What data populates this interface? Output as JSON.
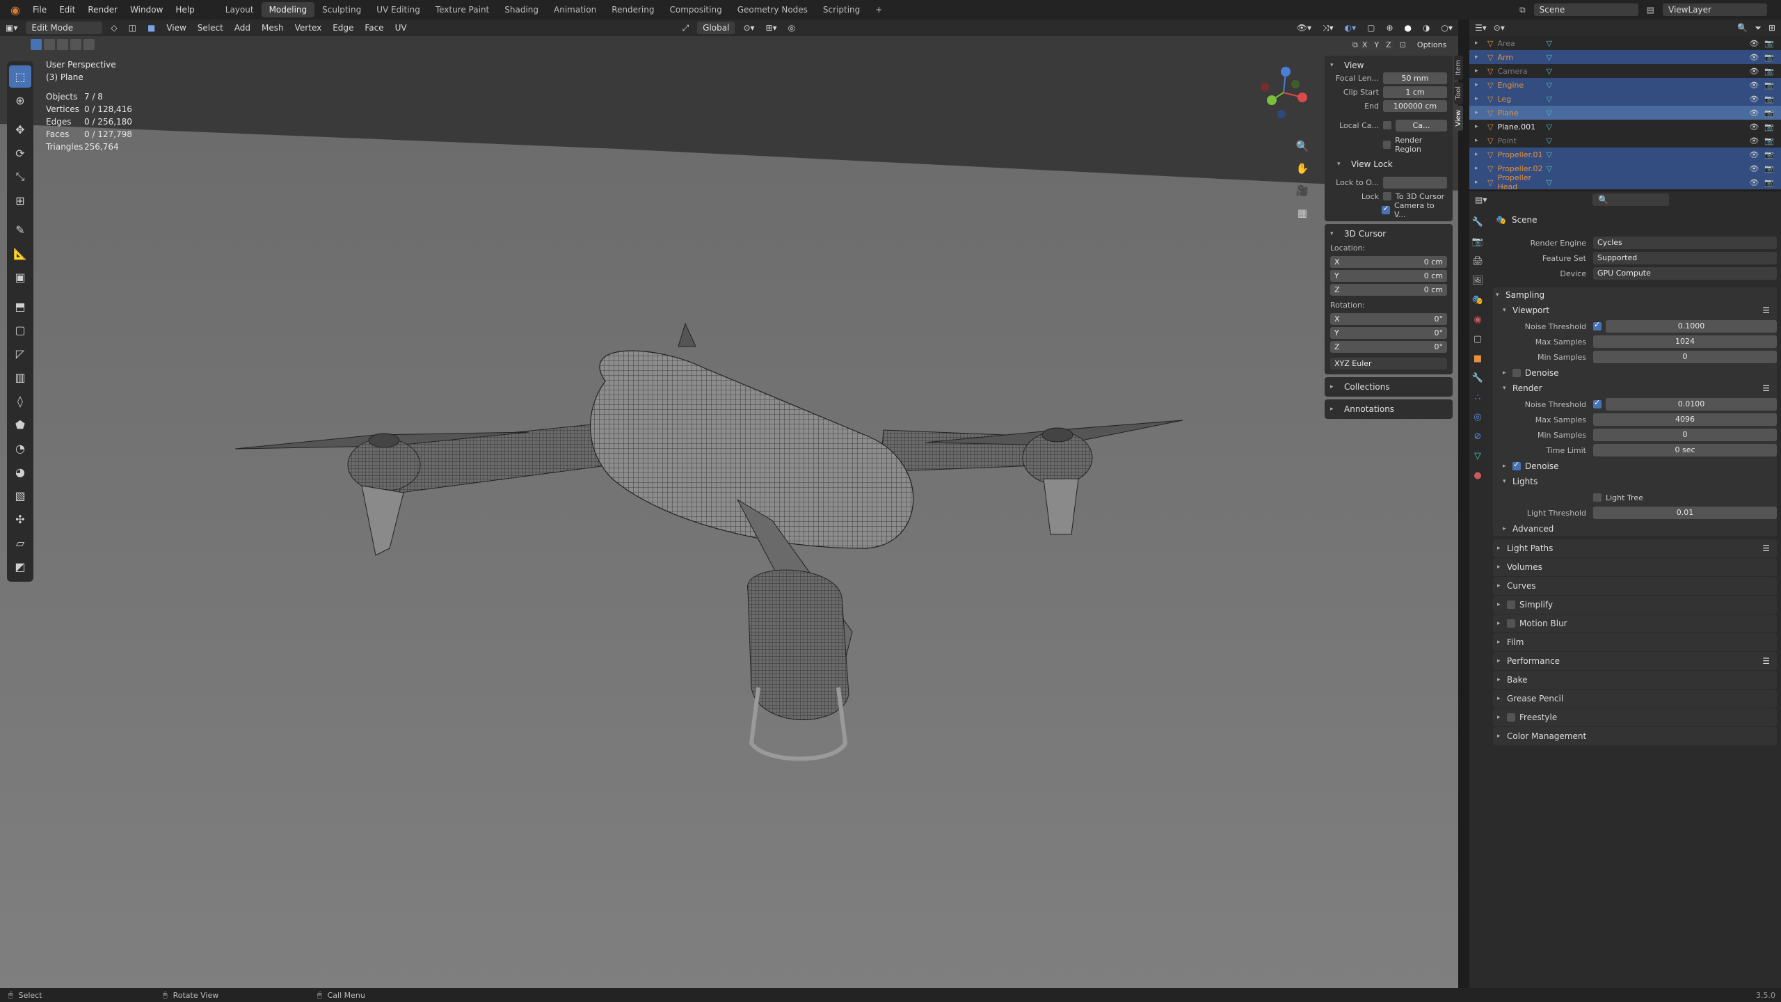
{
  "menu": [
    "File",
    "Edit",
    "Render",
    "Window",
    "Help"
  ],
  "workspaces": [
    "Layout",
    "Modeling",
    "Sculpting",
    "UV Editing",
    "Texture Paint",
    "Shading",
    "Animation",
    "Rendering",
    "Compositing",
    "Geometry Nodes",
    "Scripting"
  ],
  "active_workspace": "Modeling",
  "scene_name": "Scene",
  "view_layer": "ViewLayer",
  "viewport_header": {
    "mode": "Edit Mode",
    "menus": [
      "View",
      "Select",
      "Add",
      "Mesh",
      "Vertex",
      "Edge",
      "Face",
      "UV"
    ],
    "orientation": "Global",
    "options": "Options",
    "axes": [
      "X",
      "Y",
      "Z"
    ]
  },
  "overlay": {
    "perspective": "User Perspective",
    "object": "(3) Plane",
    "stats": [
      {
        "k": "Objects",
        "v": "7 / 8"
      },
      {
        "k": "Vertices",
        "v": "0 / 128,416"
      },
      {
        "k": "Edges",
        "v": "0 / 256,180"
      },
      {
        "k": "Faces",
        "v": "0 / 127,798"
      },
      {
        "k": "Triangles",
        "v": "256,764"
      }
    ]
  },
  "npanel": {
    "tabs": [
      "Item",
      "Tool",
      "View"
    ],
    "view": {
      "title": "View",
      "focal_label": "Focal Len...",
      "focal": "50 mm",
      "clip_start_label": "Clip Start",
      "clip_start": "1 cm",
      "end_label": "End",
      "end": "100000 cm",
      "local_camera_label": "Local Ca...",
      "local_camera": "Ca...",
      "render_region": "Render Region"
    },
    "view_lock": {
      "title": "View Lock",
      "lock_to_label": "Lock to O...",
      "lock_label": "Lock",
      "to_cursor": "To 3D Cursor",
      "camera_to_view": "Camera to V..."
    },
    "cursor": {
      "title": "3D Cursor",
      "location_label": "Location:",
      "location": [
        {
          "axis": "X",
          "value": "0 cm"
        },
        {
          "axis": "Y",
          "value": "0 cm"
        },
        {
          "axis": "Z",
          "value": "0 cm"
        }
      ],
      "rotation_label": "Rotation:",
      "rotation": [
        {
          "axis": "X",
          "value": "0°"
        },
        {
          "axis": "Y",
          "value": "0°"
        },
        {
          "axis": "Z",
          "value": "0°"
        }
      ],
      "mode": "XYZ Euler"
    },
    "collections": "Collections",
    "annotations": "Annotations"
  },
  "outliner": {
    "rows": [
      "Area",
      "Arm",
      "Camera",
      "Engine",
      "Leg",
      "Plane",
      "Plane.001",
      "Point",
      "Propeller.01",
      "Propeller.02",
      "Propeller Head"
    ]
  },
  "properties": {
    "context": "Scene",
    "render_engine_label": "Render Engine",
    "render_engine": "Cycles",
    "feature_set_label": "Feature Set",
    "feature_set": "Supported",
    "device_label": "Device",
    "device": "GPU Compute",
    "sampling": "Sampling",
    "viewport": "Viewport",
    "vp_noise_label": "Noise Threshold",
    "vp_noise": "0.1000",
    "vp_max_label": "Max Samples",
    "vp_max": "1024",
    "vp_min_label": "Min Samples",
    "vp_min": "0",
    "denoise": "Denoise",
    "render": "Render",
    "r_noise_label": "Noise Threshold",
    "r_noise": "0.0100",
    "r_max_label": "Max Samples",
    "r_max": "4096",
    "r_min_label": "Min Samples",
    "r_min": "0",
    "r_time_label": "Time Limit",
    "r_time": "0 sec",
    "r_denoise": "Denoise",
    "lights": "Lights",
    "light_tree": "Light Tree",
    "light_threshold_label": "Light Threshold",
    "light_threshold": "0.01",
    "advanced": "Advanced",
    "panels": [
      "Light Paths",
      "Volumes",
      "Curves",
      "Simplify",
      "Motion Blur",
      "Film",
      "Performance",
      "Bake",
      "Grease Pencil",
      "Freestyle",
      "Color Management"
    ]
  },
  "statusbar": {
    "select": "Select",
    "rotate": "Rotate View",
    "menu": "Call Menu",
    "version": "3.5.0"
  },
  "colors": {
    "accent": "#4772b3",
    "object_orange": "#e5913e",
    "modifier_teal": "#4fc2b9",
    "viewport_bg": "#3a3a3a"
  }
}
